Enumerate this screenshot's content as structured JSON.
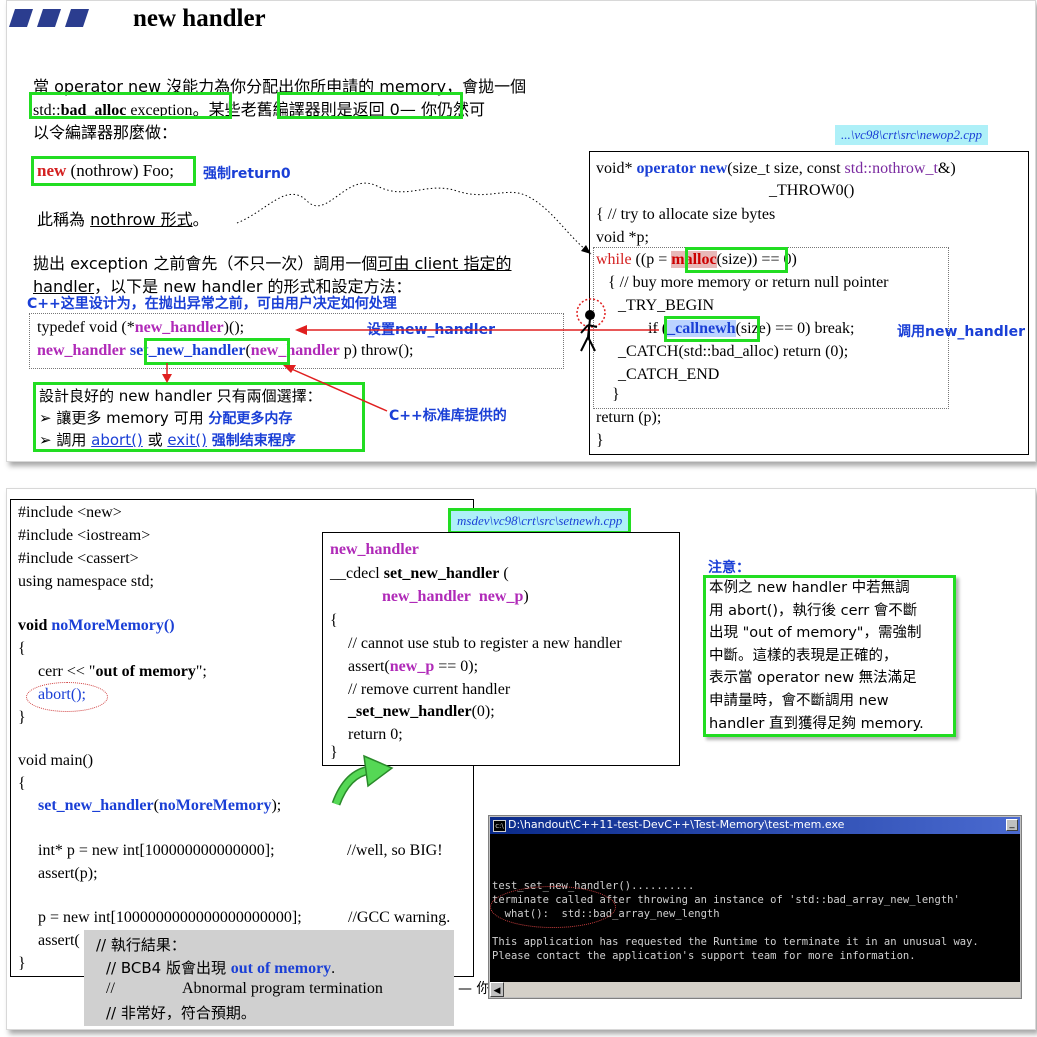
{
  "slide1": {
    "title": "new handler",
    "para1_line1": "當 operator new 沒能力為你分配出你所申請的 memory，會拋一個",
    "para1_l2_a": "std::",
    "para1_l2_b": "bad_alloc",
    "para1_l2_c": " exception",
    "para1_l2_d": "。某些",
    "para1_l2_e": "老舊編譯器則是返回 0",
    "para1_l2_f": "— 你仍然可",
    "para1_line3": "以令編譯器那麼做：",
    "nothrow_new": "new",
    "nothrow_rest": " (nothrow) Foo;",
    "nothrow_note": "强制return0",
    "nothrow_form_a": "此稱為 ",
    "nothrow_form_b": "nothrow 形式",
    "nothrow_form_c": "。",
    "para2_l1_a": "拋出 exception 之前會先（不只一次）調用一個",
    "para2_l1_b": "可由 client 指定的",
    "para2_l2_a": "handler",
    "para2_l2_b": "，以下是 new handler 的形式和設定方法：",
    "cpp_note": "C++这里设计为，在抛出异常之前，可由用户决定如何处理",
    "typedef_a": "typedef void (*",
    "typedef_b": "new_handler",
    "typedef_c": ")();",
    "decl_a": "new_handler",
    "decl_b": "set_new_handler",
    "decl_c": "(",
    "decl_d": "new_handler",
    "decl_e": " p) throw();",
    "set_note": "设置new_handler",
    "stdlib_note": "C++标准库提供的",
    "good_l1": "設計良好的 new handler 只有兩個選擇：",
    "good_l2_a": "讓更多 memory 可用",
    "good_l2_note": "分配更多内存",
    "good_l3_a": "調用 ",
    "good_l3_b": "abort()",
    "good_l3_c": " 或 ",
    "good_l3_d": "exit()",
    "good_l3_note": "强制结束程序",
    "file_label": "...\\vc98\\crt\\src\\newop2.cpp",
    "code": {
      "l1_a": "void* ",
      "l1_b": "operator new",
      "l1_c": "(size_t size, const ",
      "l1_d": "std::nothrow_t",
      "l1_e": "&)",
      "l2": "_THROW0()",
      "l3": "{   // try to allocate size bytes",
      "l4": "void *p;",
      "l5_a": "while",
      "l5_b": " ((p = ",
      "l5_c": "malloc",
      "l5_d": "(size)",
      "l5_e": ") == 0)",
      "l6": "{ // buy more memory or return null pointer",
      "l7": "_TRY_BEGIN",
      "l8_a": "if (",
      "l8_b": "_callnewh",
      "l8_c": "(size) == 0)  break;",
      "l8_note": "调用new_handler",
      "l9": "_CATCH(std::bad_alloc)    return (0);",
      "l10": "_CATCH_END",
      "l11": "}",
      "l12": "return (p);",
      "l13": "}"
    }
  },
  "slide2": {
    "main_code": {
      "l1": "#include <new>",
      "l2": "#include <iostream>",
      "l3": "#include <cassert>",
      "l4": "using namespace std;",
      "l5_a": "void ",
      "l5_b": "noMoreMemory()",
      "l6": "{",
      "l7_a": "cerr << \"",
      "l7_b": "out of memory",
      "l7_c": "\";",
      "l8": "abort();",
      "l9": "}",
      "l10": "void main()",
      "l11": "{",
      "l12_a": "set_new_handler",
      "l12_b": "(",
      "l12_c": "noMoreMemory",
      "l12_d": ");",
      "l13": "int* p = new int[100000000000000];",
      "l13_comment": "//well, so BIG!",
      "l14": "assert(p);",
      "l15": "p = new int[1000000000000000000000];",
      "l15_comment": "//GCC warning.",
      "l16": "assert(",
      "l17": "}"
    },
    "result": {
      "l1": "// 執行結果：",
      "l2_a": "// BCB4 版會出現 ",
      "l2_b": "out of memory",
      "l2_c": ".",
      "l3_a": "//",
      "l3_b": "Abnormal program termination",
      "l4": "// 非常好，符合預期。"
    },
    "trailing": "— 你",
    "file_label": "msdev\\vc98\\crt\\src\\setnewh.cpp",
    "snh": {
      "l1": "new_handler",
      "l2_a": "__cdecl ",
      "l2_b": "set_new_handler",
      "l2_c": " (",
      "l3_a": "new_handler",
      "l3_b": "new_p",
      "l3_c": ")",
      "l4": "{",
      "l5": "// cannot use stub to register a new handler",
      "l6_a": "assert(",
      "l6_b": "new_p",
      "l6_c": " == 0);",
      "l7": "// remove current handler",
      "l8_a": "_set_new_handler",
      "l8_b": "(0);",
      "l9": "return 0;",
      "l10": "}"
    },
    "note_title": "注意：",
    "note_lines": [
      "本例之 new handler 中若無調",
      "用 abort()，執行後 cerr 會不斷",
      "出現 \"out of memory\"，需強制",
      "中斷。這樣的表現是正確的，",
      "表示當 operator new 無法滿足",
      "申請量時，會不斷調用 new",
      "handler 直到獲得足夠 memory."
    ],
    "console": {
      "title": "D:\\handout\\C++11-test-DevC++\\Test-Memory\\test-mem.exe",
      "min_btn": "_",
      "lines": [
        "test_set_new_handler()..........",
        "terminate called after throwing an instance of 'std::bad_array_new_length'",
        "  what():  std::bad_array_new_length",
        "",
        "This application has requested the Runtime to terminate it in an unusual way.",
        "Please contact the application's support team for more information."
      ],
      "scroll_left": "◀"
    }
  },
  "colors": {
    "green": "#22dd22",
    "blue": "#1a3fd6",
    "red": "#d42020",
    "magenta": "#b02ab8"
  }
}
